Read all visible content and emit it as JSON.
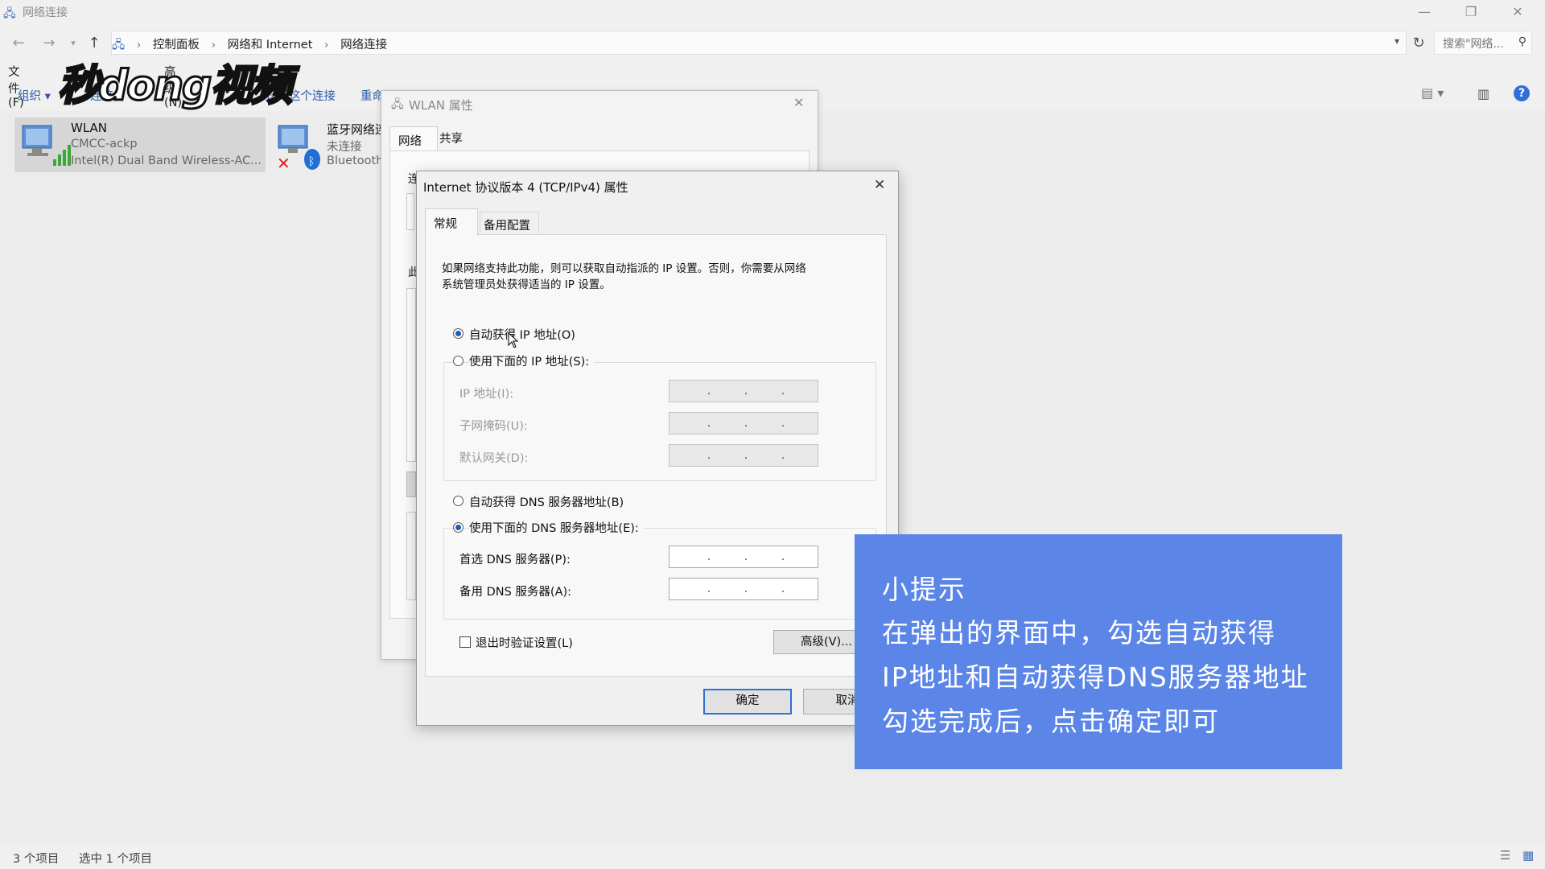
{
  "window": {
    "title": "网络连接"
  },
  "address": {
    "crumbs": [
      "控制面板",
      "网络和 Internet",
      "网络连接"
    ],
    "search_placeholder": "搜索\"网络..."
  },
  "menubar": {
    "file": "文件(F)",
    "advanced": "高级(N)"
  },
  "toolbar": {
    "organize": "组织 ▾",
    "connect": "连接",
    "diagnose": "诊断这个连接",
    "rename": "重命"
  },
  "connections": [
    {
      "name": "WLAN",
      "ssid": "CMCC-ackp",
      "device": "Intel(R) Dual Band Wireless-AC..."
    },
    {
      "name": "蓝牙网络连",
      "status": "未连接",
      "device": "Bluetooth"
    }
  ],
  "wlan_dialog": {
    "title": "WLAN 属性",
    "tabs": [
      "网络",
      "共享"
    ],
    "fragment1": "连",
    "fragment2": "此"
  },
  "ipv4_dialog": {
    "title": "Internet 协议版本 4 (TCP/IPv4) 属性",
    "tabs": [
      "常规",
      "备用配置"
    ],
    "description": [
      "如果网络支持此功能，则可以获取自动指派的 IP 设置。否则，你需要从网络",
      "系统管理员处获得适当的 IP 设置。"
    ],
    "auto_ip": "自动获得 IP 地址(O)",
    "manual_ip": "使用下面的 IP 地址(S):",
    "ip_label": "IP 地址(I):",
    "mask_label": "子网掩码(U):",
    "gateway_label": "默认网关(D):",
    "auto_dns": "自动获得 DNS 服务器地址(B)",
    "manual_dns": "使用下面的 DNS 服务器地址(E):",
    "preferred_dns": "首选 DNS 服务器(P):",
    "alternate_dns": "备用 DNS 服务器(A):",
    "validate": "退出时验证设置(L)",
    "advanced": "高级(V)...",
    "ok": "确定",
    "cancel": "取消"
  },
  "tip": {
    "heading": "小提示",
    "lines": [
      "在弹出的界面中，勾选自动获得",
      "IP地址和自动获得DNS服务器地址",
      "勾选完成后，点击确定即可"
    ]
  },
  "status": {
    "count": "3 个项目",
    "selected": "选中 1 个项目"
  },
  "watermark": "秒dong视频"
}
